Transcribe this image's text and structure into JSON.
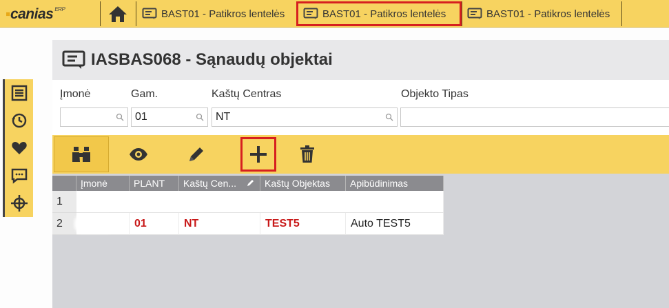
{
  "app": {
    "logo_main": "canias",
    "logo_suffix": "ERP",
    "tabs": [
      {
        "label": "BAST01 - Patikros lentelės",
        "active": false
      },
      {
        "label": "BAST01 - Patikros lentelės",
        "active": true
      },
      {
        "label": "BAST01 - Patikros lentelės",
        "active": false
      }
    ]
  },
  "sidebar": {
    "items": [
      "list-icon",
      "history-icon",
      "heart-icon",
      "chat-icon",
      "target-icon"
    ]
  },
  "page": {
    "title": "IASBAS068 - Sąnaudų objektai"
  },
  "filters": {
    "imone": {
      "label": "Įmonė",
      "value": ""
    },
    "gam": {
      "label": "Gam.",
      "value": "01"
    },
    "kastu_centras": {
      "label": "Kaštų Centras",
      "value": "NT"
    },
    "objekto_tipas": {
      "label": "Objekto Tipas",
      "value": ""
    }
  },
  "toolbar": {
    "buttons": [
      "binoculars-icon",
      "eye-icon",
      "pencil-icon",
      "plus-icon",
      "trash-icon"
    ]
  },
  "grid": {
    "columns": [
      "Įmonė",
      "PLANT",
      "Kaštų Cen...",
      "Kaštų Objektas",
      "Apibūdinimas"
    ],
    "rows": [
      {
        "num": "1",
        "imone": "",
        "plant": "",
        "kastu_centras": "",
        "kastu_objektas": "",
        "apibudinimas": ""
      },
      {
        "num": "2",
        "imone": "",
        "plant": "01",
        "kastu_centras": "NT",
        "kastu_objektas": "TEST5",
        "apibudinimas": "Auto TEST5"
      }
    ]
  },
  "colors": {
    "accent_yellow": "#f7d360",
    "highlight_red": "#d61f1f",
    "value_red": "#c81818"
  }
}
